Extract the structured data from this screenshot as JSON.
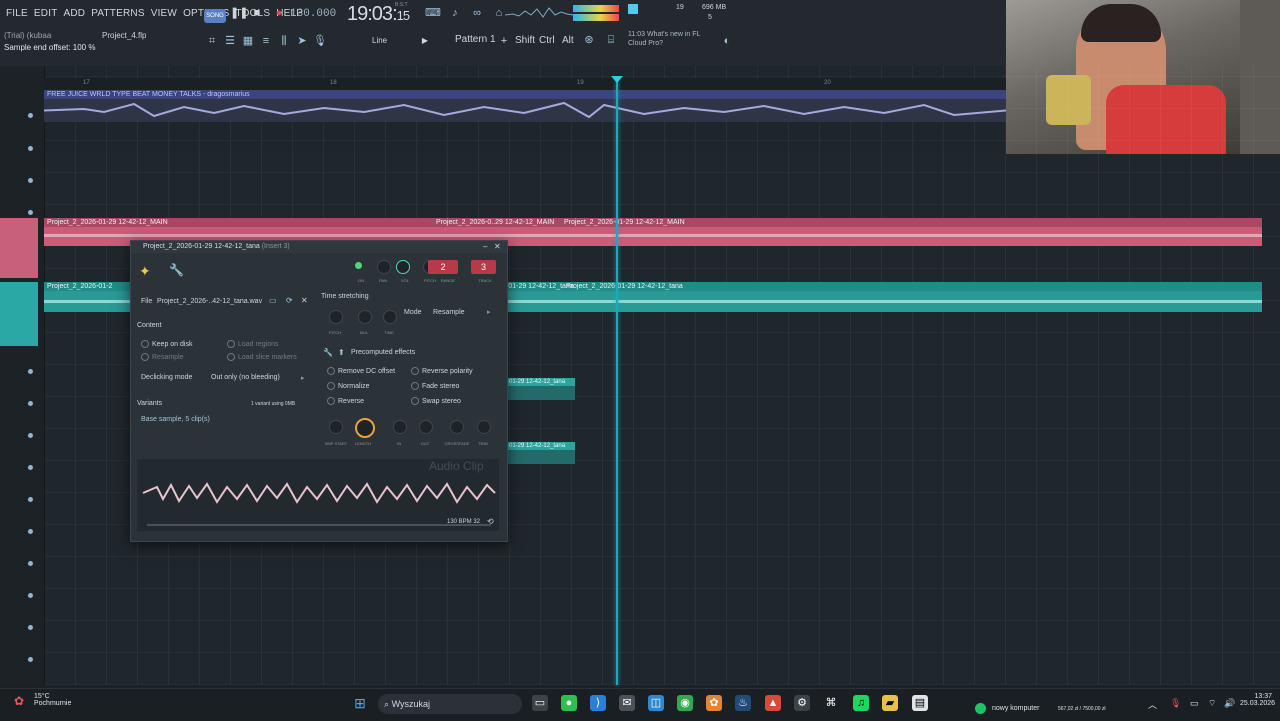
{
  "menu": [
    "FILE",
    "EDIT",
    "ADD",
    "PATTERNS",
    "VIEW",
    "OPTIONS",
    "TOOLS",
    "HELP"
  ],
  "transport": {
    "song_mode": "SONG",
    "tempo": "130.000",
    "time_main": "19:03",
    "time_sub": "15",
    "time_label": "B:S:T"
  },
  "hints": {
    "line1": "(Trial) (kubaa",
    "line2": "Sample end offset: 100 %",
    "project": "Project_4.flp"
  },
  "toolbar": {
    "snap_label": "Line",
    "pattern_label": "Pattern 1",
    "mod_shift": "Shift",
    "mod_ctrl": "Ctrl",
    "mod_alt": "Alt"
  },
  "news": {
    "time": "11:03",
    "line1": "What's new in FL",
    "line2": "Cloud Pro?"
  },
  "cpu": {
    "mem": "696 MB",
    "voices": "19",
    "poly": "5"
  },
  "playlist": {
    "ruler": [
      "17",
      "18",
      "19",
      "20"
    ],
    "clip_top": "FREE JUICE WRLD TYPE BEAT MONEY TALKS - dragosmarius",
    "clip_pink": "Project_2_2026-01-29 12-42-12_MAIN",
    "clip_pink_2": "Project_2_2026-0..29 12-42-12_MAIN",
    "clip_pink_3": "Project_2_2026-01-29 12-42-12_MAIN",
    "clip_teal": "Project_2_2026-01-2",
    "clip_teal_2": "-01-29 12-42-12_tana",
    "clip_teal_3": "Project_2_2026-01-29 12-42-12_tana",
    "small_clip_1": "-01-29 12-42-12_tana",
    "small_clip_2": "-01-29 12-42-12_tana"
  },
  "plugin": {
    "title": "Project_2_2026-01-29 12-42-12_tana",
    "insert": "(Insert 3)",
    "knob_labels": [
      "ON",
      "PAN",
      "VOL",
      "PITCH",
      "RANGE",
      "TRACK"
    ],
    "pitch_value": "2",
    "track_value": "3",
    "file_label": "File",
    "file_name": "Project_2_2026-..42-12_tana.wav",
    "time_stretching": "Time stretching",
    "ts_knobs": [
      "PITCH",
      "MUL",
      "TIME"
    ],
    "mode_label": "Mode",
    "mode_value": "Resample",
    "content": "Content",
    "keep_on_disk": "Keep on disk",
    "resample": "Resample",
    "load_regions": "Load regions",
    "load_slice_markers": "Load slice markers",
    "declicking_label": "Declicking mode",
    "declicking_value": "Out only (no bleeding)",
    "precomputed": "Precomputed effects",
    "fx": [
      "Remove DC offset",
      "Reverse polarity",
      "Normalize",
      "Fade stereo",
      "Reverse",
      "Swap stereo"
    ],
    "fx_knobs": [
      "SMP START",
      "LENGTH",
      "IN",
      "OUT",
      "CROSSFADE",
      "TRIM"
    ],
    "variants": "Variants",
    "variants_info": "1 variant using 0MB",
    "base_sample": "Base sample, 5 clip(s)",
    "watermark": "Audio Clip",
    "bpm_info": "130 BPM 32"
  },
  "taskbar": {
    "temp": "15°C",
    "weather": "Pochmurnie",
    "search": "Wyszukaj",
    "tray_label": "nowy komputer",
    "tray_amount": "567,02 zł / 7500,00 zł",
    "clock_time": "13:37",
    "clock_date": "25.03.2026"
  },
  "colors": {
    "pink_clip": "#cc5b77",
    "teal_clip": "#2a9a96",
    "playhead": "#1fa8b8",
    "accent_red": "#b63a48"
  }
}
